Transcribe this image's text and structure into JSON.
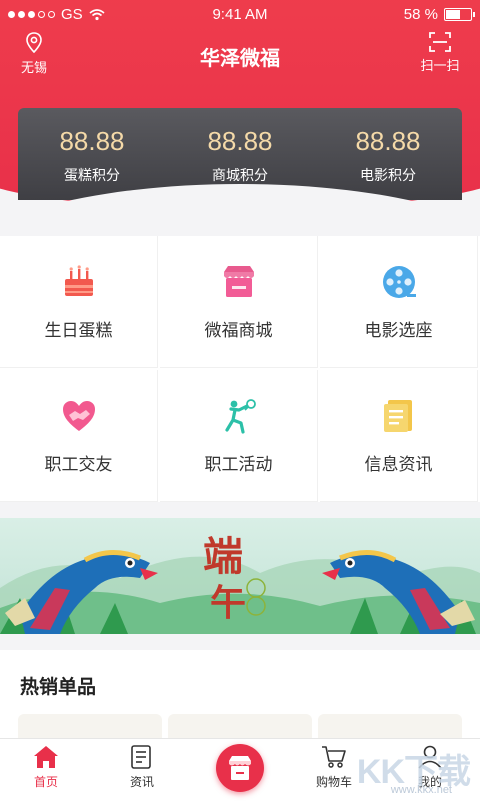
{
  "status_bar": {
    "carrier": "GS",
    "time": "9:41 AM",
    "battery": "58 %",
    "battery_level": 0.58
  },
  "nav": {
    "title": "华泽微福",
    "location": "无锡",
    "scan": "扫一扫"
  },
  "points": [
    {
      "value": "88.88",
      "label": "蛋糕积分"
    },
    {
      "value": "88.88",
      "label": "商城积分"
    },
    {
      "value": "88.88",
      "label": "电影积分"
    }
  ],
  "services": [
    {
      "label": "生日蛋糕",
      "icon": "birthday-cake-icon"
    },
    {
      "label": "微福商城",
      "icon": "store-icon"
    },
    {
      "label": "电影选座",
      "icon": "film-reel-icon"
    },
    {
      "label": "职工交友",
      "icon": "heart-handshake-icon"
    },
    {
      "label": "职工活动",
      "icon": "badminton-player-icon"
    },
    {
      "label": "信息资讯",
      "icon": "news-document-icon"
    }
  ],
  "banner": {
    "text_1": "端",
    "text_2": "午"
  },
  "hot": {
    "title": "热销单品"
  },
  "tabs": [
    {
      "label": "首页",
      "icon": "home-icon"
    },
    {
      "label": "资讯",
      "icon": "news-icon"
    },
    {
      "label": "",
      "icon": "store-icon"
    },
    {
      "label": "购物车",
      "icon": "cart-icon"
    },
    {
      "label": "我的",
      "icon": "user-icon"
    }
  ],
  "watermark": {
    "text": "KK下载",
    "url": "www.kkx.net"
  },
  "colors": {
    "brand": "#e8304a",
    "points_panel": "#4a4a4f",
    "points_value": "#f4d9a8"
  }
}
